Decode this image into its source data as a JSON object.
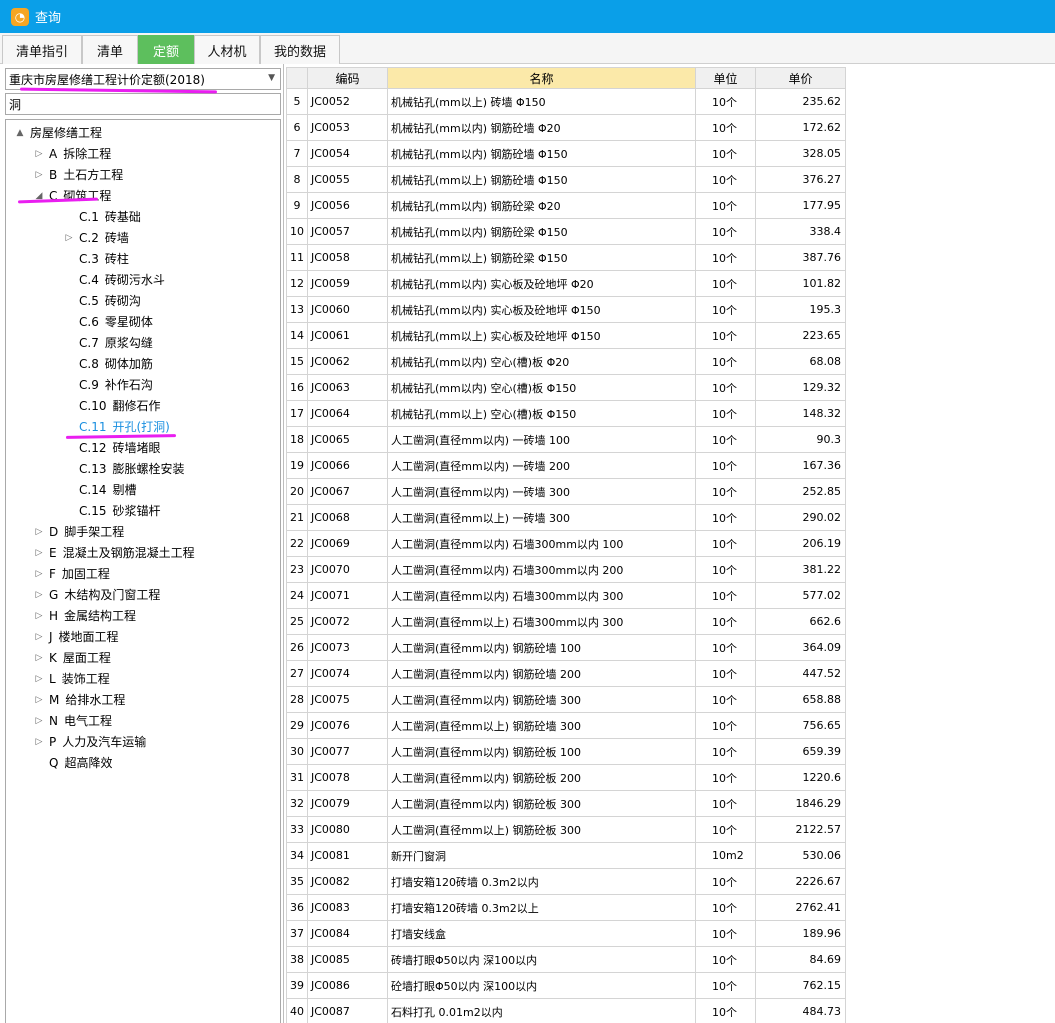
{
  "window": {
    "title": "查询",
    "icon": "app-logo-icon"
  },
  "tabs": [
    "清单指引",
    "清单",
    "定额",
    "人材机",
    "我的数据"
  ],
  "active_tab": 2,
  "left": {
    "dropdown_value": "重庆市房屋修缮工程计价定额(2018)",
    "search_value": "洞",
    "tree": [
      {
        "level": 0,
        "toggle": "▲",
        "code": "",
        "label": "房屋修缮工程"
      },
      {
        "level": 1,
        "toggle": "▷",
        "code": "A",
        "label": "拆除工程"
      },
      {
        "level": 1,
        "toggle": "▷",
        "code": "B",
        "label": "土石方工程"
      },
      {
        "level": 1,
        "toggle": "◢",
        "code": "C",
        "label": "砌筑工程"
      },
      {
        "level": 2,
        "toggle": "",
        "code": "C.1",
        "label": "砖基础"
      },
      {
        "level": 2,
        "toggle": "▷",
        "code": "C.2",
        "label": "砖墙"
      },
      {
        "level": 2,
        "toggle": "",
        "code": "C.3",
        "label": "砖柱"
      },
      {
        "level": 2,
        "toggle": "",
        "code": "C.4",
        "label": "砖砌污水斗"
      },
      {
        "level": 2,
        "toggle": "",
        "code": "C.5",
        "label": "砖砌沟"
      },
      {
        "level": 2,
        "toggle": "",
        "code": "C.6",
        "label": "零星砌体"
      },
      {
        "level": 2,
        "toggle": "",
        "code": "C.7",
        "label": "原浆勾缝"
      },
      {
        "level": 2,
        "toggle": "",
        "code": "C.8",
        "label": "砌体加筋"
      },
      {
        "level": 2,
        "toggle": "",
        "code": "C.9",
        "label": "补作石沟"
      },
      {
        "level": 2,
        "toggle": "",
        "code": "C.10",
        "label": "翻修石作"
      },
      {
        "level": 2,
        "toggle": "",
        "code": "C.11",
        "label": "开孔(打洞)",
        "selected": true
      },
      {
        "level": 2,
        "toggle": "",
        "code": "C.12",
        "label": "砖墙堵眼"
      },
      {
        "level": 2,
        "toggle": "",
        "code": "C.13",
        "label": "膨胀螺栓安装"
      },
      {
        "level": 2,
        "toggle": "",
        "code": "C.14",
        "label": "剔槽"
      },
      {
        "level": 2,
        "toggle": "",
        "code": "C.15",
        "label": "砂浆锚杆"
      },
      {
        "level": 1,
        "toggle": "▷",
        "code": "D",
        "label": "脚手架工程"
      },
      {
        "level": 1,
        "toggle": "▷",
        "code": "E",
        "label": "混凝土及钢筋混凝土工程"
      },
      {
        "level": 1,
        "toggle": "▷",
        "code": "F",
        "label": "加固工程"
      },
      {
        "level": 1,
        "toggle": "▷",
        "code": "G",
        "label": "木结构及门窗工程"
      },
      {
        "level": 1,
        "toggle": "▷",
        "code": "H",
        "label": "金属结构工程"
      },
      {
        "level": 1,
        "toggle": "▷",
        "code": "J",
        "label": "楼地面工程"
      },
      {
        "level": 1,
        "toggle": "▷",
        "code": "K",
        "label": "屋面工程"
      },
      {
        "level": 1,
        "toggle": "▷",
        "code": "L",
        "label": "装饰工程"
      },
      {
        "level": 1,
        "toggle": "▷",
        "code": "M",
        "label": "给排水工程"
      },
      {
        "level": 1,
        "toggle": "▷",
        "code": "N",
        "label": "电气工程"
      },
      {
        "level": 1,
        "toggle": "▷",
        "code": "P",
        "label": "人力及汽车运输"
      },
      {
        "level": 1,
        "toggle": "",
        "code": "Q",
        "label": "超高降效"
      }
    ]
  },
  "table": {
    "headers": [
      "",
      "编码",
      "名称",
      "单位",
      "单价"
    ],
    "highlight_color": "#fbe9a9",
    "rows": [
      [
        "5",
        "JC0052",
        "机械钻孔(mm以上) 砖墙 Φ150",
        "10个",
        "235.62"
      ],
      [
        "6",
        "JC0053",
        "机械钻孔(mm以内) 钢筋砼墙 Φ20",
        "10个",
        "172.62"
      ],
      [
        "7",
        "JC0054",
        "机械钻孔(mm以内) 钢筋砼墙 Φ150",
        "10个",
        "328.05"
      ],
      [
        "8",
        "JC0055",
        "机械钻孔(mm以上) 钢筋砼墙 Φ150",
        "10个",
        "376.27"
      ],
      [
        "9",
        "JC0056",
        "机械钻孔(mm以内) 钢筋砼梁 Φ20",
        "10个",
        "177.95"
      ],
      [
        "10",
        "JC0057",
        "机械钻孔(mm以内) 钢筋砼梁 Φ150",
        "10个",
        "338.4"
      ],
      [
        "11",
        "JC0058",
        "机械钻孔(mm以上) 钢筋砼梁 Φ150",
        "10个",
        "387.76"
      ],
      [
        "12",
        "JC0059",
        "机械钻孔(mm以内) 实心板及砼地坪 Φ20",
        "10个",
        "101.82"
      ],
      [
        "13",
        "JC0060",
        "机械钻孔(mm以内) 实心板及砼地坪 Φ150",
        "10个",
        "195.3"
      ],
      [
        "14",
        "JC0061",
        "机械钻孔(mm以上) 实心板及砼地坪 Φ150",
        "10个",
        "223.65"
      ],
      [
        "15",
        "JC0062",
        "机械钻孔(mm以内) 空心(槽)板 Φ20",
        "10个",
        "68.08"
      ],
      [
        "16",
        "JC0063",
        "机械钻孔(mm以内) 空心(槽)板 Φ150",
        "10个",
        "129.32"
      ],
      [
        "17",
        "JC0064",
        "机械钻孔(mm以上) 空心(槽)板 Φ150",
        "10个",
        "148.32"
      ],
      [
        "18",
        "JC0065",
        "人工凿洞(直径mm以内) 一砖墙 100",
        "10个",
        "90.3"
      ],
      [
        "19",
        "JC0066",
        "人工凿洞(直径mm以内) 一砖墙 200",
        "10个",
        "167.36"
      ],
      [
        "20",
        "JC0067",
        "人工凿洞(直径mm以内) 一砖墙 300",
        "10个",
        "252.85"
      ],
      [
        "21",
        "JC0068",
        "人工凿洞(直径mm以上) 一砖墙 300",
        "10个",
        "290.02"
      ],
      [
        "22",
        "JC0069",
        "人工凿洞(直径mm以内) 石墙300mm以内 100",
        "10个",
        "206.19"
      ],
      [
        "23",
        "JC0070",
        "人工凿洞(直径mm以内) 石墙300mm以内 200",
        "10个",
        "381.22"
      ],
      [
        "24",
        "JC0071",
        "人工凿洞(直径mm以内) 石墙300mm以内 300",
        "10个",
        "577.02"
      ],
      [
        "25",
        "JC0072",
        "人工凿洞(直径mm以上) 石墙300mm以内 300",
        "10个",
        "662.6"
      ],
      [
        "26",
        "JC0073",
        "人工凿洞(直径mm以内) 钢筋砼墙 100",
        "10个",
        "364.09"
      ],
      [
        "27",
        "JC0074",
        "人工凿洞(直径mm以内) 钢筋砼墙 200",
        "10个",
        "447.52"
      ],
      [
        "28",
        "JC0075",
        "人工凿洞(直径mm以内) 钢筋砼墙 300",
        "10个",
        "658.88"
      ],
      [
        "29",
        "JC0076",
        "人工凿洞(直径mm以上) 钢筋砼墙 300",
        "10个",
        "756.65"
      ],
      [
        "30",
        "JC0077",
        "人工凿洞(直径mm以内) 钢筋砼板 100",
        "10个",
        "659.39"
      ],
      [
        "31",
        "JC0078",
        "人工凿洞(直径mm以内) 钢筋砼板 200",
        "10个",
        "1220.6"
      ],
      [
        "32",
        "JC0079",
        "人工凿洞(直径mm以内) 钢筋砼板 300",
        "10个",
        "1846.29"
      ],
      [
        "33",
        "JC0080",
        "人工凿洞(直径mm以上) 钢筋砼板 300",
        "10个",
        "2122.57"
      ],
      [
        "34",
        "JC0081",
        "新开门窗洞",
        "10m2",
        "530.06"
      ],
      [
        "35",
        "JC0082",
        "打墙安箱120砖墙 0.3m2以内",
        "10个",
        "2226.67"
      ],
      [
        "36",
        "JC0083",
        "打墙安箱120砖墙 0.3m2以上",
        "10个",
        "2762.41"
      ],
      [
        "37",
        "JC0084",
        "打墙安线盒",
        "10个",
        "189.96"
      ],
      [
        "38",
        "JC0085",
        "砖墙打眼Φ50以内 深100以内",
        "10个",
        "84.69"
      ],
      [
        "39",
        "JC0086",
        "砼墙打眼Φ50以内 深100以内",
        "10个",
        "762.15"
      ],
      [
        "40",
        "JC0087",
        "石料打孔 0.01m2以内",
        "10个",
        "484.73"
      ]
    ]
  }
}
